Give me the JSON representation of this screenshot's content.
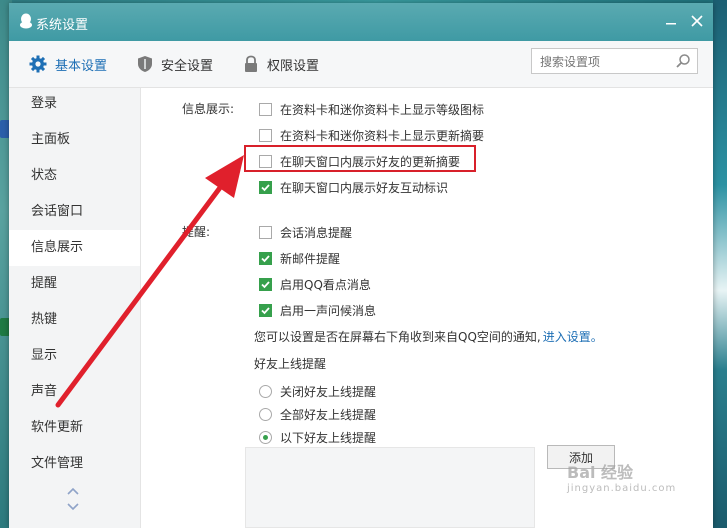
{
  "window": {
    "title": "系统设置"
  },
  "tabs": [
    {
      "label": "基本设置",
      "icon": "gear-icon"
    },
    {
      "label": "安全设置",
      "icon": "shield-icon"
    },
    {
      "label": "权限设置",
      "icon": "lock-icon"
    }
  ],
  "search": {
    "placeholder": "搜索设置项"
  },
  "sidebar": {
    "items": [
      {
        "label": "登录"
      },
      {
        "label": "主面板"
      },
      {
        "label": "状态"
      },
      {
        "label": "会话窗口"
      },
      {
        "label": "信息展示",
        "active": true
      },
      {
        "label": "提醒"
      },
      {
        "label": "热键"
      },
      {
        "label": "显示"
      },
      {
        "label": "声音"
      },
      {
        "label": "软件更新"
      },
      {
        "label": "文件管理"
      }
    ]
  },
  "info_display": {
    "label": "信息展示:",
    "options": [
      {
        "label": "在资料卡和迷你资料卡上显示等级图标",
        "checked": false
      },
      {
        "label": "在资料卡和迷你资料卡上显示更新摘要",
        "checked": false
      },
      {
        "label": "在聊天窗口内展示好友的更新摘要",
        "checked": false
      },
      {
        "label": "在聊天窗口内展示好友互动标识",
        "checked": true
      }
    ]
  },
  "reminder": {
    "label": "提醒:",
    "options": [
      {
        "label": "会话消息提醒",
        "checked": false
      },
      {
        "label": "新邮件提醒",
        "checked": true
      },
      {
        "label": "启用QQ看点消息",
        "checked": true
      },
      {
        "label": "启用一声问候消息",
        "checked": true
      }
    ],
    "qzone_text": "您可以设置是否在屏幕右下角收到来自QQ空间的通知,",
    "qzone_link": "进入设置。"
  },
  "friend_online": {
    "label": "好友上线提醒",
    "options": [
      {
        "label": "关闭好友上线提醒",
        "selected": false
      },
      {
        "label": "全部好友上线提醒",
        "selected": false
      },
      {
        "label": "以下好友上线提醒",
        "selected": true
      }
    ],
    "add_label": "添加"
  },
  "watermark": {
    "line1": "Bai  经验",
    "line2": "jingyan.baidu.com"
  },
  "colors": {
    "titlebar": "#3f9aa4",
    "accent": "#1e6fb5",
    "check": "#36a04c",
    "highlight": "#d8202a"
  }
}
